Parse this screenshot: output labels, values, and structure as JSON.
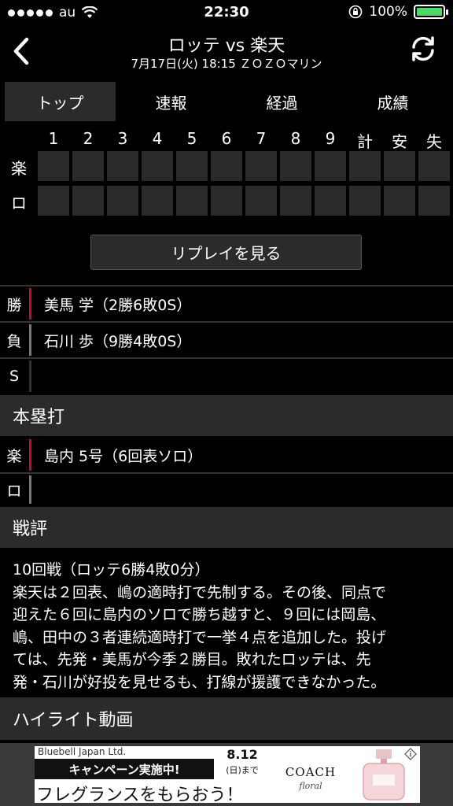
{
  "status_bar": {
    "carrier": "au",
    "time": "22:30",
    "battery_percent": "100%",
    "battery_level": 1.0
  },
  "nav": {
    "title": "ロッテ vs 楽天",
    "subtitle": "7月17日(火) 18:15 ＺＯＺＯマリン"
  },
  "tabs": [
    {
      "label": "トップ",
      "active": true
    },
    {
      "label": "速報",
      "active": false
    },
    {
      "label": "経過",
      "active": false
    },
    {
      "label": "成績",
      "active": false
    }
  ],
  "scoreboard": {
    "headers": [
      "1",
      "2",
      "3",
      "4",
      "5",
      "6",
      "7",
      "8",
      "9",
      "計",
      "安",
      "失"
    ],
    "teams": [
      {
        "label": "楽",
        "scores": [
          "",
          "",
          "",
          "",
          "",
          "",
          "",
          "",
          "",
          "",
          "",
          ""
        ]
      },
      {
        "label": "ロ",
        "scores": [
          "",
          "",
          "",
          "",
          "",
          "",
          "",
          "",
          "",
          "",
          "",
          ""
        ]
      }
    ]
  },
  "replay_button": "リプレイを見る",
  "pitchers": {
    "win": {
      "label": "勝",
      "text": "美馬 学（2勝6敗0S）"
    },
    "loss": {
      "label": "負",
      "text": "石川 歩（9勝4敗0S）"
    },
    "save": {
      "label": "S",
      "text": ""
    }
  },
  "homeruns": {
    "title": "本塁打",
    "rows": [
      {
        "label": "楽",
        "text": "島内 5号（6回表ソロ）"
      },
      {
        "label": "ロ",
        "text": ""
      }
    ]
  },
  "review": {
    "title": "戦評",
    "lines": [
      "10回戦（ロッテ6勝4敗0分）",
      "楽天は２回表、嶋の適時打で先制する。その後、同点で",
      "迎えた６回に島内のソロで勝ち越すと、９回には岡島、",
      "嶋、田中の３者連続適時打で一挙４点を追加した。投げ",
      "ては、先発・美馬が今季２勝目。敗れたロッテは、先",
      "発・石川が好投を見せるも、打線が援護できなかった。"
    ]
  },
  "highlight": {
    "title": "ハイライト動画"
  },
  "ad": {
    "company": "Bluebell Japan Ltd.",
    "campaign": "キャンペーン実施中!",
    "date": "8.12",
    "date_sub": "(日)まで",
    "headline": "フレグランスをもらおう！",
    "brand": "COACH",
    "brand_sub": "floral"
  },
  "colors": {
    "win_bar": "#b0182e",
    "neutral_bar": "#777777",
    "panel": "#2b2b2b",
    "cell": "#2a2a2a"
  }
}
